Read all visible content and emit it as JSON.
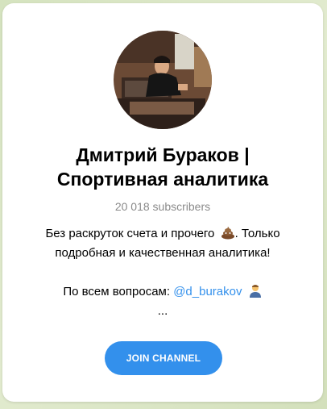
{
  "channel": {
    "title_line1": "Дмитрий Бураков |",
    "title_line2": "Спортивная аналитика",
    "subscribers": "20 018 subscribers",
    "description": {
      "line1_text": "Без раскруток счета и прочего",
      "line1_emoji": "poo-emoji",
      "line1_after": ". Только",
      "line2": "подробная и качественная аналитика!",
      "line4_text": "По всем вопросам: ",
      "mention": "@d_burakov",
      "line4_emoji": "person-emoji",
      "line5": "..."
    }
  },
  "actions": {
    "join_label": "JOIN CHANNEL"
  },
  "colors": {
    "accent": "#3390ec",
    "card": "#ffffff",
    "muted_text": "#8a8a8a",
    "background": "#dbe6c8"
  }
}
